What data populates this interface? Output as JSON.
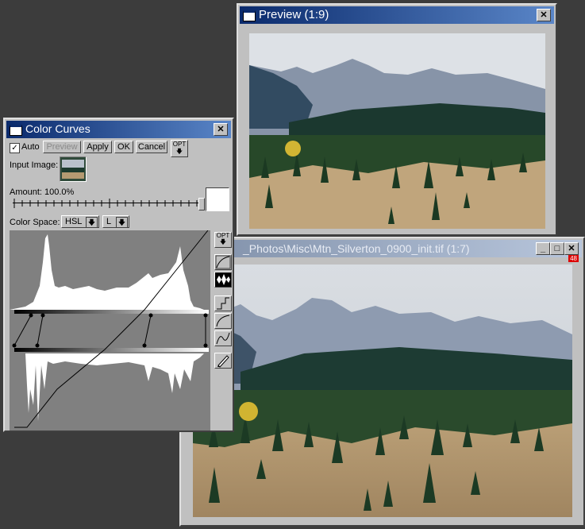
{
  "preview_window": {
    "title": "Preview (1:9)",
    "close_label": "✕"
  },
  "main_window": {
    "title": "_Photos\\Misc\\Mtn_Silverton_0900_init.tif (1:7)",
    "badge": "48",
    "min_label": "_",
    "max_label": "□",
    "close_label": "✕"
  },
  "curves_window": {
    "title": "Color Curves",
    "close_label": "✕",
    "auto_checked": true,
    "auto_label": "Auto",
    "preview_label": "Preview",
    "apply_label": "Apply",
    "ok_label": "OK",
    "cancel_label": "Cancel",
    "opt_label": "OPT",
    "input_image_label": "Input Image:",
    "amount_label": "Amount: 100.0%",
    "amount_value": 1.0,
    "color_space_label": "Color Space:",
    "color_space_value": "HSL",
    "channel_value": "L"
  },
  "colors": {
    "title_active": "#0a2a6c",
    "title_inactive": "#7f8fa8",
    "desktop": "#3c3c3c",
    "panel": "#c0c0c0",
    "graph_bg": "#808080"
  }
}
